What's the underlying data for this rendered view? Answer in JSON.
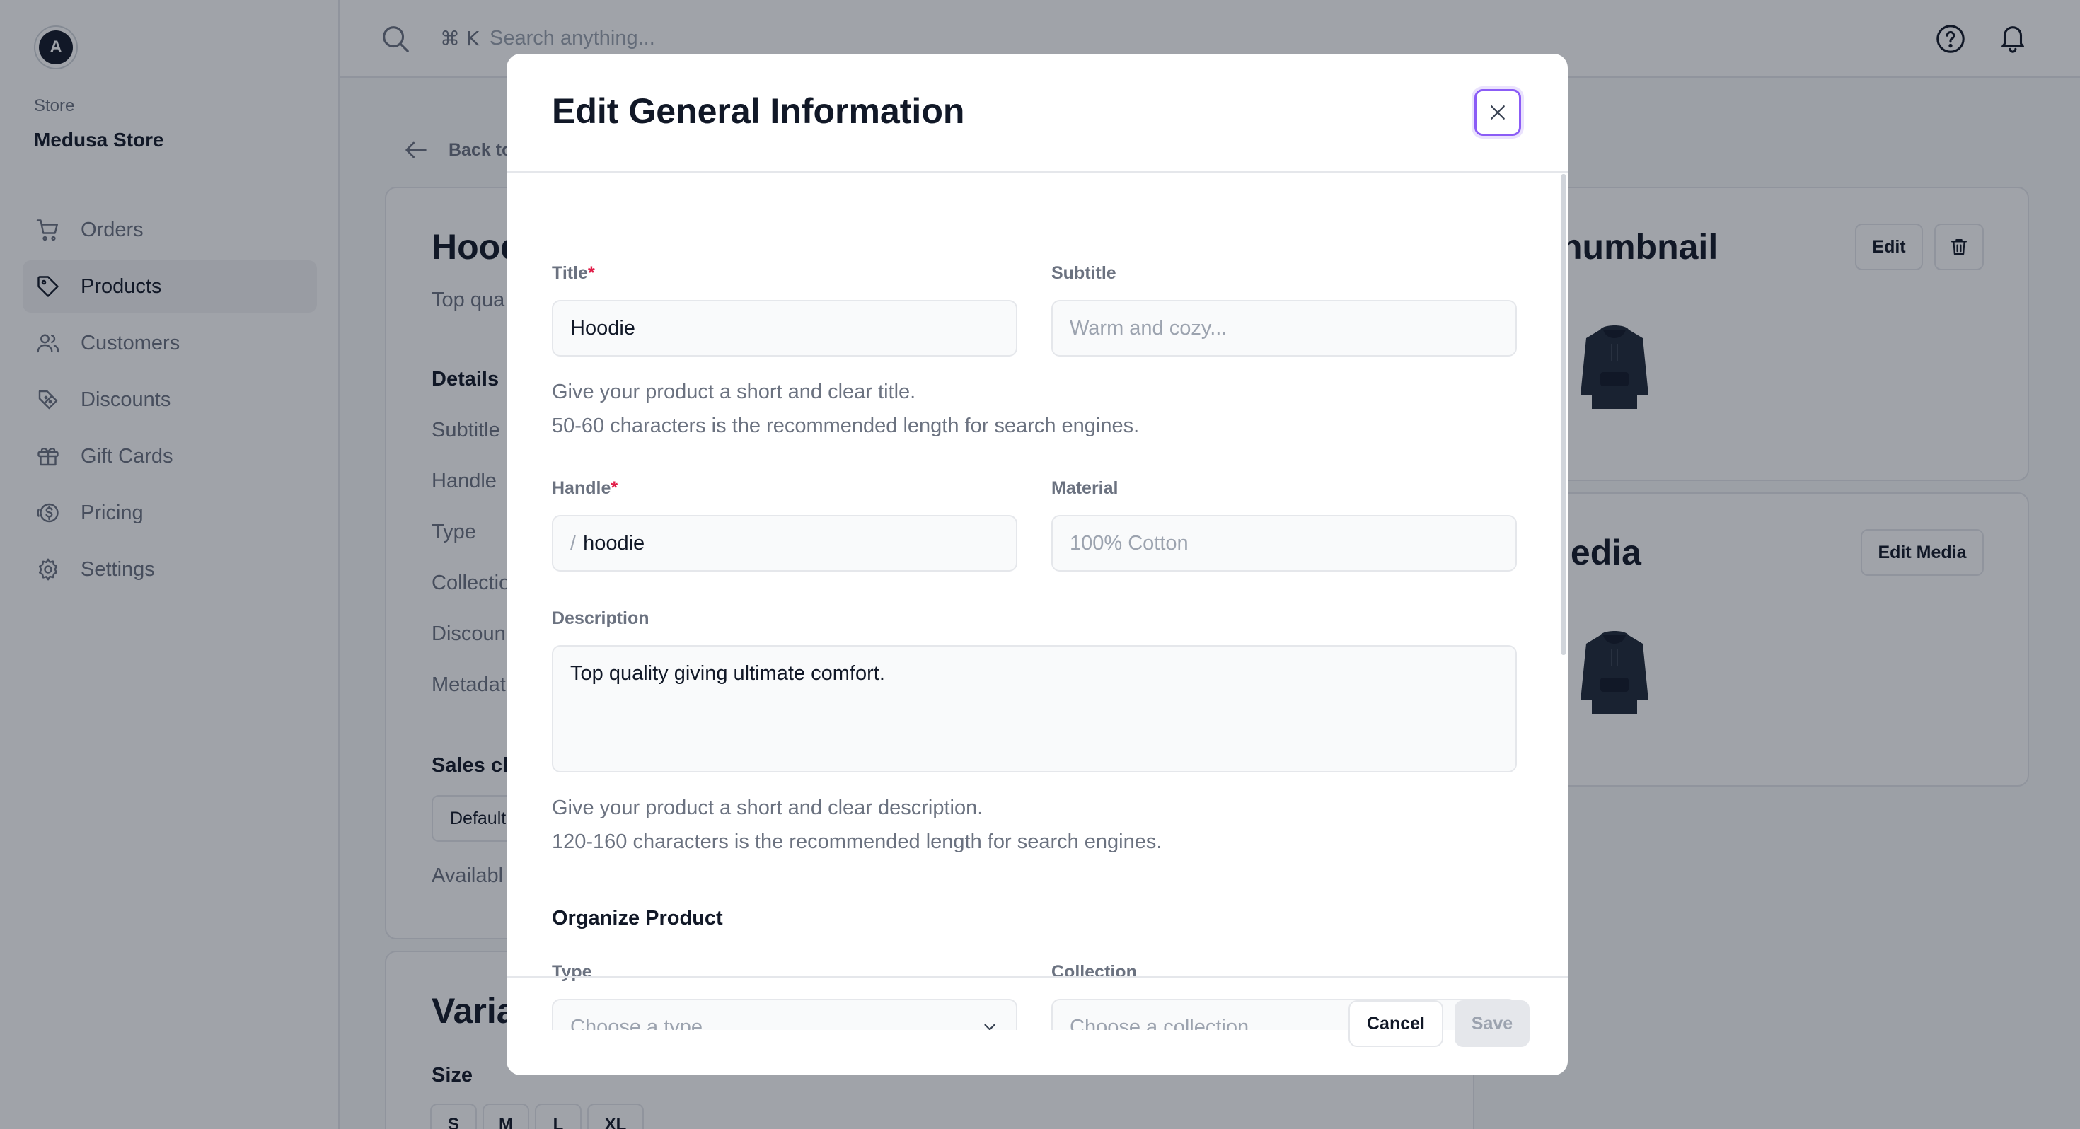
{
  "sidebar": {
    "avatar_initial": "A",
    "store_label": "Store",
    "store_name": "Medusa Store",
    "items": [
      {
        "label": "Orders",
        "icon": "cart-icon"
      },
      {
        "label": "Products",
        "icon": "tag-icon",
        "active": true
      },
      {
        "label": "Customers",
        "icon": "users-icon"
      },
      {
        "label": "Discounts",
        "icon": "discount-icon"
      },
      {
        "label": "Gift Cards",
        "icon": "gift-icon"
      },
      {
        "label": "Pricing",
        "icon": "dollar-icon"
      },
      {
        "label": "Settings",
        "icon": "gear-icon"
      }
    ]
  },
  "topbar": {
    "shortcut": "⌘ K",
    "search_placeholder": "Search anything..."
  },
  "background": {
    "back_label": "Back to",
    "product_title": "Hood",
    "product_desc": "Top qua",
    "details_heading": "Details",
    "detail_rows": [
      "Subtitle",
      "Handle",
      "Type",
      "Collectio",
      "Discoun",
      "Metadat"
    ],
    "sales_heading": "Sales ch",
    "sales_default": "Default",
    "available": "Availabl",
    "variants_title": "Varia",
    "size_label": "Size",
    "sizes": [
      "S",
      "M",
      "L",
      "XL"
    ],
    "thumbnail_title": "humbnail",
    "thumbnail_edit": "Edit",
    "media_title": "ledia",
    "media_edit": "Edit Media"
  },
  "modal": {
    "title": "Edit General Information",
    "title_label": "Title",
    "title_value": "Hoodie",
    "subtitle_label": "Subtitle",
    "subtitle_placeholder": "Warm and cozy...",
    "title_help_1": "Give your product a short and clear title.",
    "title_help_2": "50-60 characters is the recommended length for search engines.",
    "handle_label": "Handle",
    "handle_prefix": "/",
    "handle_value": "hoodie",
    "material_label": "Material",
    "material_placeholder": "100% Cotton",
    "description_label": "Description",
    "description_value": "Top quality giving ultimate comfort.",
    "desc_help_1": "Give your product a short and clear description.",
    "desc_help_2": "120-160 characters is the recommended length for search engines.",
    "organize_heading": "Organize Product",
    "type_label": "Type",
    "type_placeholder": "Choose a type",
    "collection_label": "Collection",
    "collection_placeholder": "Choose a collection",
    "required_mark": "*",
    "cancel_label": "Cancel",
    "save_label": "Save"
  },
  "colors": {
    "accent_focus": "#8b5cf6",
    "required": "#e11d48",
    "overlay": "rgba(17,24,39,0.40)"
  }
}
